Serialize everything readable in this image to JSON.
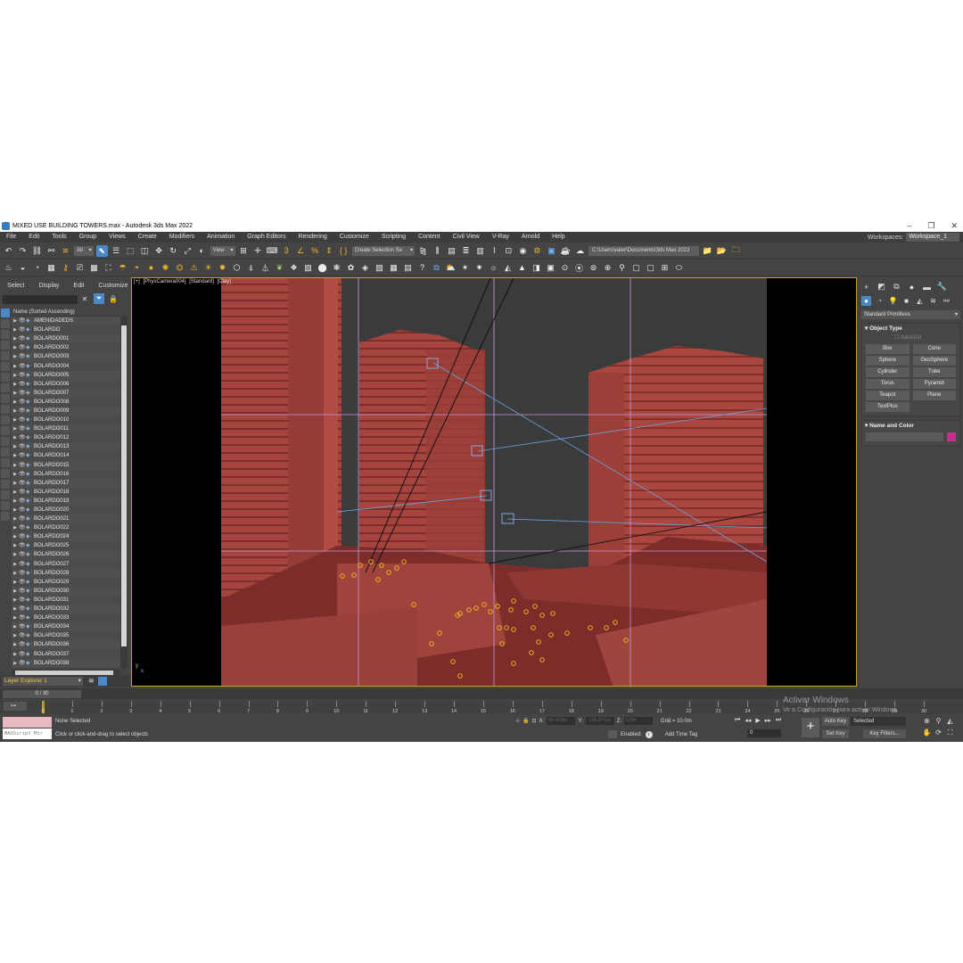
{
  "window": {
    "title": "MIXED USE BUILDING TOWERS.max - Autodesk 3ds Max 2022",
    "minimize": "–",
    "maximize": "❐",
    "close": "✕"
  },
  "menu": {
    "items": [
      "File",
      "Edit",
      "Tools",
      "Group",
      "Views",
      "Create",
      "Modifiers",
      "Animation",
      "Graph Editors",
      "Rendering",
      "Customize",
      "Scripting",
      "Content",
      "Civil View",
      "V-Ray",
      "Arnold",
      "Help"
    ],
    "workspace_label": "Workspaces:",
    "workspace_value": "Workspace_1"
  },
  "toolbar": {
    "selection_filter": "All",
    "ref_coord": "View",
    "named_selection": "Create Selection Se",
    "project_path": "C:\\Users\\valer\\Documents\\3ds Max 2022"
  },
  "explorer": {
    "menu": [
      "Select",
      "Display",
      "Edit",
      "Customize"
    ],
    "column_header": "Name (Sorted Ascending)",
    "items": [
      "AMENIDADEDS",
      "BOLARDO",
      "BOLARDO001",
      "BOLARDO002",
      "BOLARDO003",
      "BOLARDO004",
      "BOLARDO005",
      "BOLARDO006",
      "BOLARDO007",
      "BOLARDO008",
      "BOLARDO009",
      "BOLARDO010",
      "BOLARDO011",
      "BOLARDO012",
      "BOLARDO013",
      "BOLARDO014",
      "BOLARDO015",
      "BOLARDO016",
      "BOLARDO017",
      "BOLARDO018",
      "BOLARDO019",
      "BOLARDO020",
      "BOLARDO021",
      "BOLARDO022",
      "BOLARDO024",
      "BOLARDO025",
      "BOLARDO026",
      "BOLARDO027",
      "BOLARDO028",
      "BOLARDO029",
      "BOLARDO030",
      "BOLARDO031",
      "BOLARDO032",
      "BOLARDO033",
      "BOLARDO034",
      "BOLARDO035",
      "BOLARDO036",
      "BOLARDO037",
      "BOLARDO038"
    ],
    "layer_explorer": "Layer Explorer 1"
  },
  "viewport": {
    "label_plus": "[+]",
    "label_camera": "[PhysCamera004]",
    "label_shading": "[Standard]",
    "label_mode": "[Clay]",
    "axis_x": "x",
    "axis_y": "y"
  },
  "command_panel": {
    "category": "Standard Primitives",
    "object_type_title": "Object Type",
    "autogrid": "AutoGrid",
    "primitives": [
      "Box",
      "Cone",
      "Sphere",
      "GeoSphere",
      "Cylinder",
      "Tube",
      "Torus",
      "Pyramid",
      "Teapot",
      "Plane",
      "TextPlus"
    ],
    "name_color_title": "Name and Color",
    "color_swatch": "#c4308a"
  },
  "timeline": {
    "time_slider": "0 / 30",
    "ticks": [
      "0",
      "1",
      "2",
      "3",
      "4",
      "5",
      "6",
      "7",
      "8",
      "9",
      "10",
      "11",
      "12",
      "13",
      "14",
      "15",
      "16",
      "17",
      "18",
      "19",
      "20",
      "21",
      "22",
      "23",
      "24",
      "25",
      "26",
      "27",
      "28",
      "29",
      "30"
    ]
  },
  "status": {
    "maxscript": "MAXScript Mir",
    "selection": "None Selected",
    "prompt": "Click or click-and-drag to select objects",
    "x_label": "X:",
    "x_value": "60.423m",
    "y_label": "Y:",
    "y_value": "-106.571m",
    "z_label": "Z:",
    "z_value": "0.0m",
    "grid": "Grid = 10.0m",
    "enabled": "Enabled:",
    "add_time_tag": "Add Time Tag",
    "auto_key": "Auto Key",
    "set_key": "Set Key",
    "key_mode": "Selected",
    "key_filters": "Key Filters...",
    "frame": "0"
  },
  "watermark": {
    "line1": "Activar Windows",
    "line2": "Ve a Configuración para activar Windows."
  },
  "colors": {
    "accent": "#4a88c7",
    "viewport_frame": "#c8a028",
    "building_clay": "#a8453f",
    "sky": "#3a3a3a"
  }
}
